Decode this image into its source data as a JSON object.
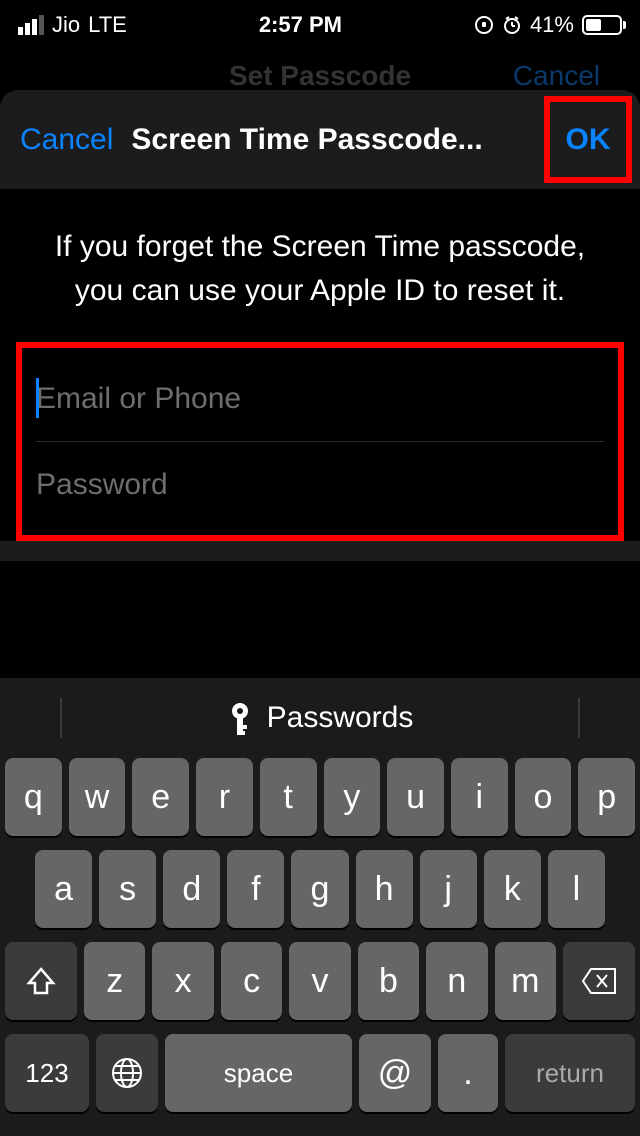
{
  "status": {
    "carrier": "Jio",
    "network": "LTE",
    "time": "2:57 PM",
    "battery": "41%"
  },
  "underlay": {
    "title": "Set Passcode",
    "cancel": "Cancel"
  },
  "modal": {
    "cancel": "Cancel",
    "title": "Screen Time Passcode...",
    "ok": "OK",
    "info": "If you forget the Screen Time passcode, you can use your Apple ID to reset it.",
    "email_placeholder": "Email or Phone",
    "password_placeholder": "Password"
  },
  "keyboard": {
    "suggest": "Passwords",
    "row1": [
      "q",
      "w",
      "e",
      "r",
      "t",
      "y",
      "u",
      "i",
      "o",
      "p"
    ],
    "row2": [
      "a",
      "s",
      "d",
      "f",
      "g",
      "h",
      "j",
      "k",
      "l"
    ],
    "row3": [
      "z",
      "x",
      "c",
      "v",
      "b",
      "n",
      "m"
    ],
    "numkey": "123",
    "space": "space",
    "at": "@",
    "dot": ".",
    "return": "return"
  }
}
